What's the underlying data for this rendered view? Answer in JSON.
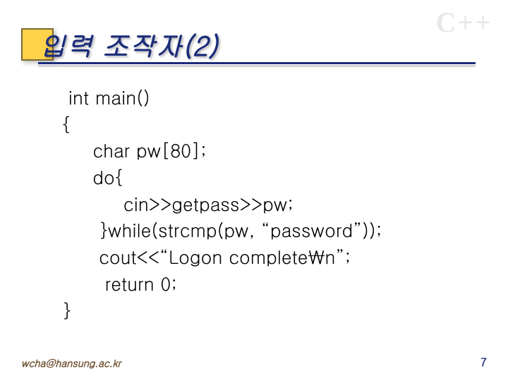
{
  "watermark": "C++",
  "title": "입력 조작자(2)",
  "code": {
    "l1": " int main()",
    "l2": "{",
    "l3": "     char pw[80];",
    "l4": "     do{",
    "l5": "          cin>>getpass>>pw;",
    "l6": "      }while(strcmp(pw, “password”));",
    "l7": "      cout<<“Logon complete₩n”;",
    "l8": "       return 0;",
    "l9": "}"
  },
  "footer": {
    "email": "wcha@hansung.ac.kr",
    "page": "7"
  }
}
